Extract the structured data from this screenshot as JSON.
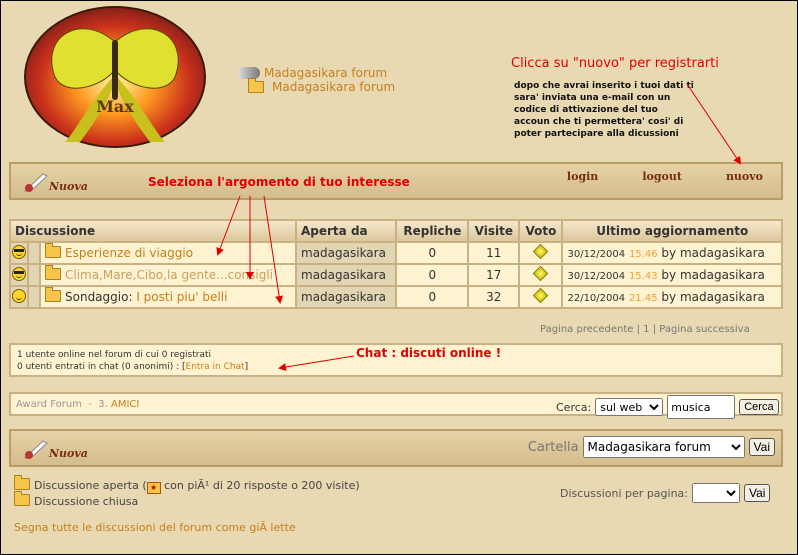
{
  "breadcrumb": [
    "Madagasikara forum",
    "Madagasikara forum"
  ],
  "notes": {
    "register_title": "Clicca su \"nuovo\" per registrarti",
    "register_text": "dopo che avrai inserito i tuoi dati ti sara' inviata una e-mail con un codice di attivazione del tuo accoun che ti permettera' cosi' di poter partecipare alla dicussioni",
    "select_topic": "Seleziona l'argomento di tuo interesse",
    "chat": "Chat : discuti online !"
  },
  "toolbar": {
    "new_label": "Nuova",
    "login": "login",
    "logout": "logout",
    "register": "nuovo"
  },
  "table": {
    "columns": [
      "Discussione",
      "Aperta da",
      "Repliche",
      "Visite",
      "Voto",
      "Ultimo aggiornamento"
    ],
    "rows": [
      {
        "topic": "Esperienze di viaggio",
        "author": "madagasikara",
        "replies": "0",
        "views": "11",
        "date": "30/12/2004",
        "time": "15.46",
        "by": "by madagasikara"
      },
      {
        "topic": "Clima,Mare,Cibo,la gente...consigli",
        "author": "madagasikara",
        "replies": "0",
        "views": "17",
        "date": "30/12/2004",
        "time": "15.43",
        "by": "by madagasikara"
      },
      {
        "prefix": "Sondaggio:",
        "topic": "I posti piu' belli",
        "author": "madagasikara",
        "replies": "0",
        "views": "32",
        "date": "22/10/2004",
        "time": "21.45",
        "by": "by madagasikara"
      }
    ]
  },
  "pager": {
    "prev": "Pagina precedente",
    "current": "1",
    "next": "Pagina successiva"
  },
  "online": {
    "users": "1 utente online nel forum di cui 0 registrati",
    "chat_prefix": "0 utenti entrati in chat (0 anonimi) : ",
    "chat_link": "Entra in Chat"
  },
  "award": {
    "label": "Award Forum",
    "number": "3.",
    "link": "AMICI"
  },
  "search": {
    "label": "Cerca:",
    "scope": "sul web",
    "value": "musica",
    "button": "Cerca"
  },
  "folder": {
    "label": "Cartella",
    "selected": "Madagasikara forum",
    "button": "Vai"
  },
  "legend": {
    "open": "Discussione aperta",
    "hot": "con piÃ¹ di 20 risposte o 200 visite",
    "closed": "Discussione chiusa",
    "mark_all": "Segna tutte le discussioni del forum come giÃ  lette"
  },
  "per_page": {
    "label": "Discussioni per pagina:",
    "button": "Vai"
  },
  "colors": {
    "background": "#e9d9b3",
    "link": "#c87d1c",
    "annotation": "#e10000",
    "cell": "#fff3d2"
  }
}
